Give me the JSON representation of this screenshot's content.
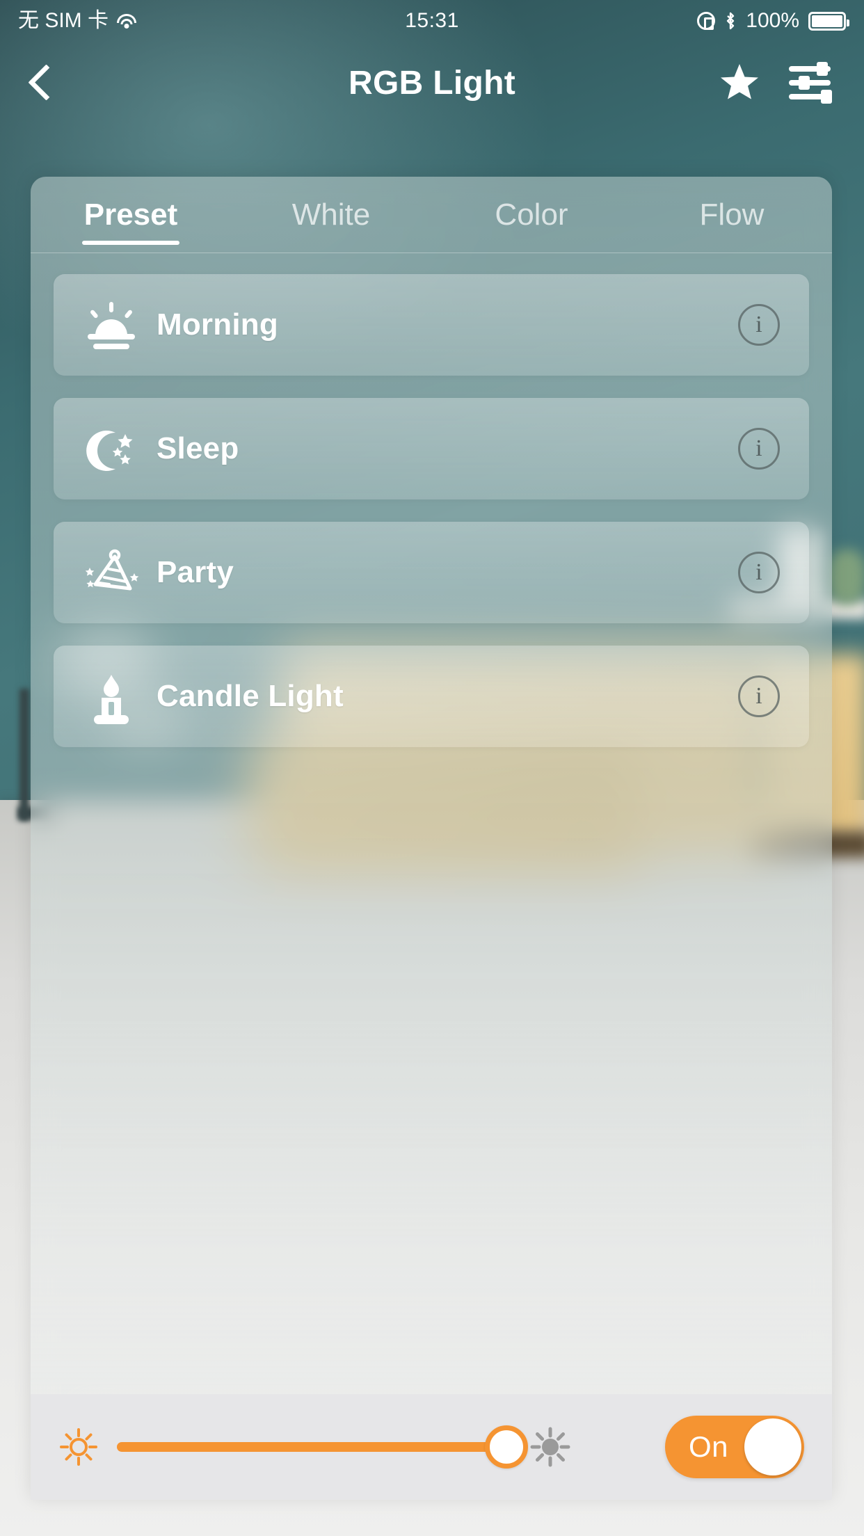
{
  "status_bar": {
    "carrier": "无 SIM 卡",
    "wifi_icon": "wifi-icon",
    "time": "15:31",
    "rotation_lock_icon": "rotation-lock-icon",
    "bluetooth_icon": "bluetooth-icon",
    "battery_percent": "100%",
    "battery_icon": "battery-full-icon"
  },
  "nav_bar": {
    "back_icon": "chevron-left-icon",
    "title": "RGB Light",
    "favorite_icon": "star-icon",
    "settings_icon": "sliders-icon"
  },
  "tabs": [
    {
      "label": "Preset",
      "active": true
    },
    {
      "label": "White",
      "active": false
    },
    {
      "label": "Color",
      "active": false
    },
    {
      "label": "Flow",
      "active": false
    }
  ],
  "presets": [
    {
      "label": "Morning",
      "icon": "sunrise-icon",
      "info": "i"
    },
    {
      "label": "Sleep",
      "icon": "moon-stars-icon",
      "info": "i"
    },
    {
      "label": "Party",
      "icon": "party-hat-icon",
      "info": "i"
    },
    {
      "label": "Candle Light",
      "icon": "candle-icon",
      "info": "i"
    }
  ],
  "bottom_bar": {
    "brightness_low_icon": "brightness-low-icon",
    "brightness_high_icon": "brightness-high-icon",
    "brightness_value": 100,
    "power_label": "On",
    "power_state": "on"
  },
  "colors": {
    "accent": "#f59432",
    "nav_bg": "#3c6b70",
    "panel_tint": "#b9cecc",
    "bottom_bar_bg": "#e6e6e8"
  }
}
